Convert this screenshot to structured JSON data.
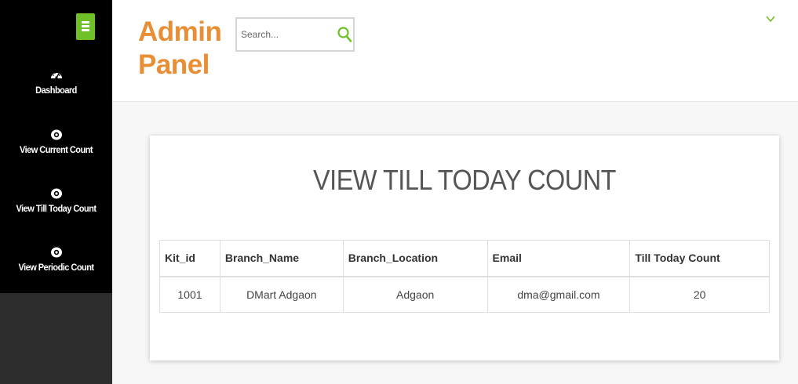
{
  "app": {
    "title_line1": "Admin",
    "title_line2": "Panel"
  },
  "search": {
    "placeholder": "Search..."
  },
  "sidebar": {
    "items": [
      {
        "label": "Dashboard",
        "icon": "dashboard-icon"
      },
      {
        "label": "View Current Count",
        "icon": "eye-icon"
      },
      {
        "label": "View Till Today Count",
        "icon": "eye-icon"
      },
      {
        "label": "View Periodic Count",
        "icon": "eye-icon"
      }
    ]
  },
  "main": {
    "title": "VIEW TILL TODAY COUNT",
    "table": {
      "headers": [
        "Kit_id",
        "Branch_Name",
        "Branch_Location",
        "Email",
        "Till Today Count"
      ],
      "rows": [
        [
          "1001",
          "DMart Adgaon",
          "Adgaon",
          "dma@gmail.com",
          "20"
        ]
      ]
    }
  },
  "colors": {
    "brand": "#e88e34",
    "accent": "#6fbf26",
    "sidebar": "#000000"
  }
}
